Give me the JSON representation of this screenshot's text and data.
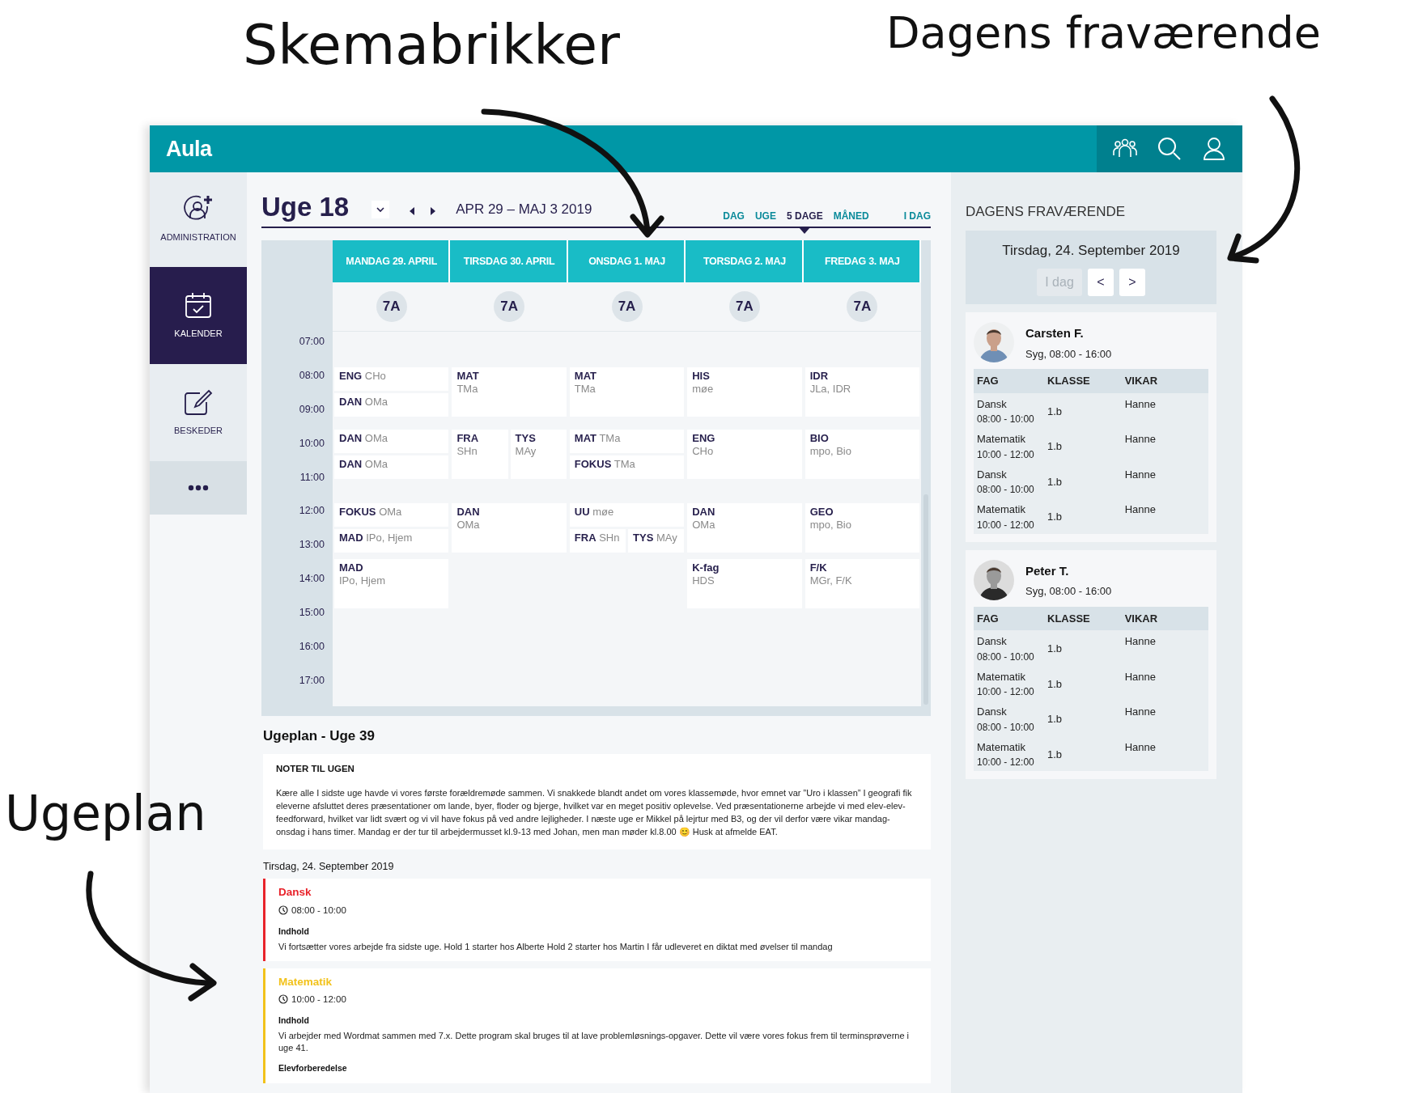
{
  "annotations": [
    {
      "text": "Skemabrikker"
    },
    {
      "text": "Dagens fraværende"
    },
    {
      "text": "Ugeplan"
    }
  ],
  "header": {
    "logo": "Aula"
  },
  "sidebar": {
    "items": [
      {
        "kind": "person-add",
        "label": "ADMINISTRATION",
        "selected": false
      },
      {
        "kind": "calendar",
        "label": "KALENDER",
        "selected": true
      },
      {
        "kind": "compose",
        "label": "BESKEDER",
        "selected": false
      },
      {
        "kind": "more",
        "selected": false
      }
    ]
  },
  "calendar": {
    "title": "Uge 18",
    "date_range": "APR 29 – MAJ 3 2019",
    "views": [
      {
        "label": "DAG",
        "selected": false
      },
      {
        "label": "UGE",
        "selected": false
      },
      {
        "label": "5 DAGE",
        "selected": true
      },
      {
        "label": "MÅNED",
        "selected": false
      }
    ],
    "today_button": "I DAG",
    "time_labels": [
      "07:00",
      "08:00",
      "09:00",
      "10:00",
      "11:00",
      "12:00",
      "13:00",
      "14:00",
      "15:00",
      "16:00",
      "17:00"
    ],
    "days": [
      {
        "header": "MANDAG 29. APRIL",
        "class": "7A",
        "bands": [
          [
            [
              {
                "subject": "ENG",
                "teacher": "CHo"
              }
            ],
            [
              {
                "subject": "DAN",
                "teacher": "OMa"
              }
            ]
          ],
          [
            [
              {
                "subject": "DAN",
                "teacher": "OMa"
              }
            ],
            [
              {
                "subject": "DAN",
                "teacher": "OMa"
              }
            ]
          ],
          [
            [
              {
                "subject": "FOKUS",
                "teacher": "OMa"
              }
            ],
            [
              {
                "subject": "MAD",
                "teacher": "IPo, Hjem"
              }
            ]
          ],
          [
            [
              {
                "subject": "MAD",
                "teacher": "IPo, Hjem"
              }
            ]
          ]
        ]
      },
      {
        "header": "TIRSDAG 30. APRIL",
        "class": "7A",
        "bands": [
          [
            [
              {
                "subject": "MAT",
                "teacher": "TMa"
              }
            ]
          ],
          [
            [
              {
                "subject": "FRA",
                "teacher": "SHn"
              },
              {
                "subject": "TYS",
                "teacher": "MAy"
              }
            ]
          ],
          [
            [
              {
                "subject": "DAN",
                "teacher": "OMa"
              }
            ]
          ]
        ]
      },
      {
        "header": "ONSDAG 1. MAJ",
        "class": "7A",
        "bands": [
          [
            [
              {
                "subject": "MAT",
                "teacher": "TMa"
              }
            ]
          ],
          [
            [
              {
                "subject": "MAT",
                "teacher": "TMa"
              }
            ],
            [
              {
                "subject": "FOKUS",
                "teacher": "TMa"
              }
            ]
          ],
          [
            [
              {
                "subject": "UU",
                "teacher": "møe"
              }
            ],
            [
              {
                "subject": "FRA",
                "teacher": "SHn"
              },
              {
                "subject": "TYS",
                "teacher": "MAy"
              }
            ]
          ]
        ]
      },
      {
        "header": "TORSDAG 2. MAJ",
        "class": "7A",
        "bands": [
          [
            [
              {
                "subject": "HIS",
                "teacher": "møe"
              }
            ]
          ],
          [
            [
              {
                "subject": "ENG",
                "teacher": "CHo"
              }
            ]
          ],
          [
            [
              {
                "subject": "DAN",
                "teacher": "OMa"
              }
            ]
          ],
          [
            [
              {
                "subject": "K-fag",
                "teacher": "HDS"
              }
            ]
          ]
        ]
      },
      {
        "header": "FREDAG 3. MAJ",
        "class": "7A",
        "bands": [
          [
            [
              {
                "subject": "IDR",
                "teacher": "JLa, IDR"
              }
            ]
          ],
          [
            [
              {
                "subject": "BIO",
                "teacher": "mpo, Bio"
              }
            ]
          ],
          [
            [
              {
                "subject": "GEO",
                "teacher": "mpo, Bio"
              }
            ]
          ],
          [
            [
              {
                "subject": "F/K",
                "teacher": "MGr, F/K"
              }
            ]
          ]
        ]
      }
    ]
  },
  "absence": {
    "title": "DAGENS FRAVÆRENDE",
    "date": "Tirsdag, 24. September 2019",
    "buttons": [
      {
        "label": "I dag",
        "disabled": true
      },
      {
        "label": "<",
        "disabled": false
      },
      {
        "label": ">",
        "disabled": false
      }
    ],
    "people": [
      {
        "name": "Carsten F.",
        "status": "Syg, 08:00 - 16:00",
        "columns": [
          "FAG",
          "KLASSE",
          "VIKAR"
        ],
        "rows": [
          {
            "subject": "Dansk",
            "time": "08:00 - 10:00",
            "class": "1.b",
            "substitute": "Hanne"
          },
          {
            "subject": "Matematik",
            "time": "10:00 - 12:00",
            "class": "1.b",
            "substitute": "Hanne"
          },
          {
            "subject": "Dansk",
            "time": "08:00 - 10:00",
            "class": "1.b",
            "substitute": "Hanne"
          },
          {
            "subject": "Matematik",
            "time": "10:00 - 12:00",
            "class": "1.b",
            "substitute": "Hanne"
          }
        ]
      },
      {
        "name": "Peter T.",
        "status": "Syg, 08:00 - 16:00",
        "columns": [
          "FAG",
          "KLASSE",
          "VIKAR"
        ],
        "rows": [
          {
            "subject": "Dansk",
            "time": "08:00 - 10:00",
            "class": "1.b",
            "substitute": "Hanne"
          },
          {
            "subject": "Matematik",
            "time": "10:00 - 12:00",
            "class": "1.b",
            "substitute": "Hanne"
          },
          {
            "subject": "Dansk",
            "time": "08:00 - 10:00",
            "class": "1.b",
            "substitute": "Hanne"
          },
          {
            "subject": "Matematik",
            "time": "10:00 - 12:00",
            "class": "1.b",
            "substitute": "Hanne"
          }
        ]
      }
    ]
  },
  "ugeplan": {
    "title": "Ugeplan - Uge 39",
    "notes": {
      "title": "NOTER TIL UGEN",
      "text": "Kære alle I sidste uge havde vi vores første forældremøde sammen. Vi snakkede blandt andet om vores klassemøde, hvor emnet var ”Uro i klassen” I geografi fik eleverne afsluttet deres præsentationer om lande, byer, floder og bjerge, hvilket var en meget positiv oplevelse. Ved præsentationerne arbejde vi med elev-elev-feedforward, hvilket var lidt svært og vi vil have fokus på ved andre lejligheder. I næste uge er Mikkel på lejrtur med B3, og der vil derfor være vikar mandag-onsdag i hans timer. Mandag er der tur til arbejdermusset kl.9-13 med Johan, men man møder kl.8.00 😊 Husk at afmelde EAT."
    },
    "date": "Tirsdag, 24. September 2019",
    "lessons": [
      {
        "subject": "Dansk",
        "color": "#e8232b",
        "time": "08:00 - 10:00",
        "sections": [
          {
            "heading": "Indhold",
            "text": "Vi fortsætter vores arbejde fra sidste uge. Hold 1 starter hos Alberte Hold 2 starter hos Martin I får udleveret en diktat med øvelser til mandag"
          }
        ]
      },
      {
        "subject": "Matematik",
        "color": "#f2c21b",
        "time": "10:00 - 12:00",
        "sections": [
          {
            "heading": "Indhold",
            "text": "Vi arbejder med Wordmat sammen med 7.x. Dette program skal bruges til at lave problemløsnings-opgaver. Dette vil være vores fokus frem til terminsprøverne i uge 41."
          },
          {
            "heading": "Elevforberedelse"
          }
        ]
      }
    ]
  }
}
